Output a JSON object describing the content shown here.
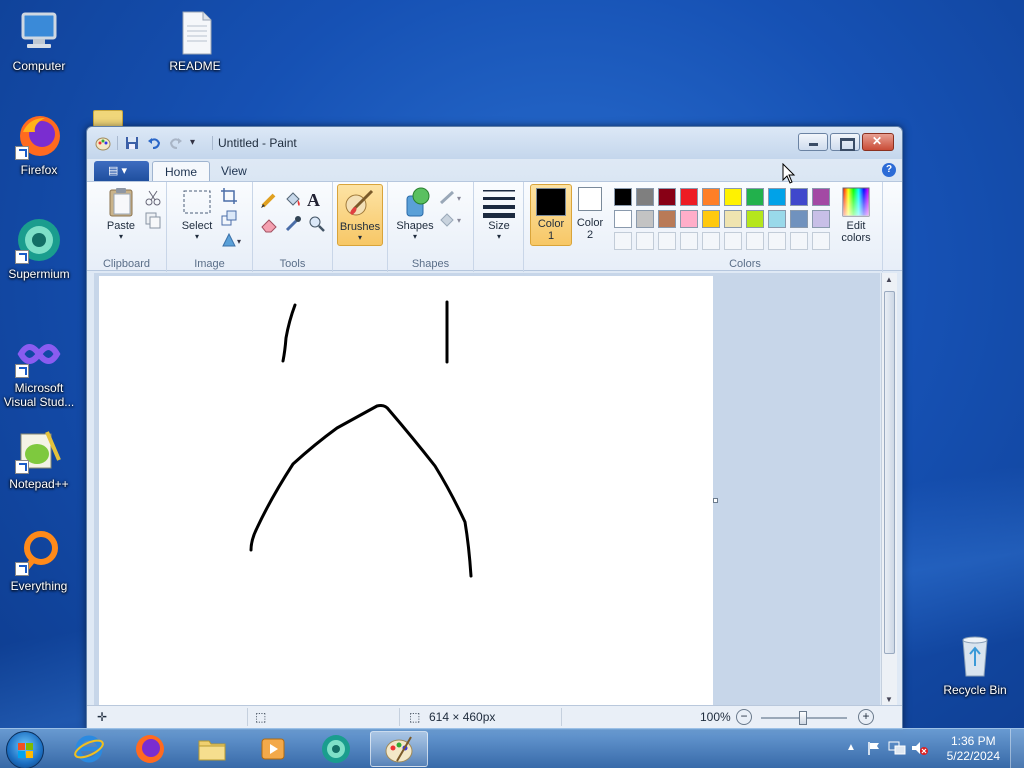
{
  "desktop": {
    "icons": [
      {
        "label": "Computer"
      },
      {
        "label": "README"
      },
      {
        "label": "Firefox"
      },
      {
        "label": "Supermium"
      },
      {
        "label": "Microsoft Visual Stud..."
      },
      {
        "label": "Notepad++"
      },
      {
        "label": "Everything"
      },
      {
        "label": "Recycle Bin"
      }
    ]
  },
  "window": {
    "title": "Untitled - Paint",
    "tabs": {
      "home": "Home",
      "view": "View"
    },
    "help_label": "?"
  },
  "ribbon": {
    "clipboard": {
      "paste": "Paste",
      "label": "Clipboard"
    },
    "image": {
      "select": "Select",
      "label": "Image"
    },
    "tools": {
      "label": "Tools",
      "text_tool": "A"
    },
    "brushes": {
      "label": "Brushes"
    },
    "shapes": {
      "label": "Shapes",
      "group_label": "Shapes"
    },
    "size": {
      "label": "Size"
    },
    "color1": {
      "label_line1": "Color",
      "label_line2": "1",
      "value": "#000000"
    },
    "color2": {
      "label_line1": "Color",
      "label_line2": "2",
      "value": "#ffffff"
    },
    "colors": {
      "label": "Colors",
      "row1": [
        "#000000",
        "#7f7f7f",
        "#880015",
        "#ed1c24",
        "#ff7f27",
        "#fff200",
        "#22b14c",
        "#00a2e8",
        "#3f48cc",
        "#a349a4"
      ],
      "row2": [
        "#ffffff",
        "#c3c3c3",
        "#b97a57",
        "#ffaec9",
        "#ffc90e",
        "#efe4b0",
        "#b5e61d",
        "#99d9ea",
        "#7092be",
        "#c8bfe7"
      ]
    },
    "edit_colors": {
      "line1": "Edit",
      "line2": "colors"
    }
  },
  "status": {
    "canvas_size": "614 × 460px",
    "zoom": "100%"
  },
  "taskbar": {
    "clock_time": "1:36 PM",
    "clock_date": "5/22/2024"
  }
}
